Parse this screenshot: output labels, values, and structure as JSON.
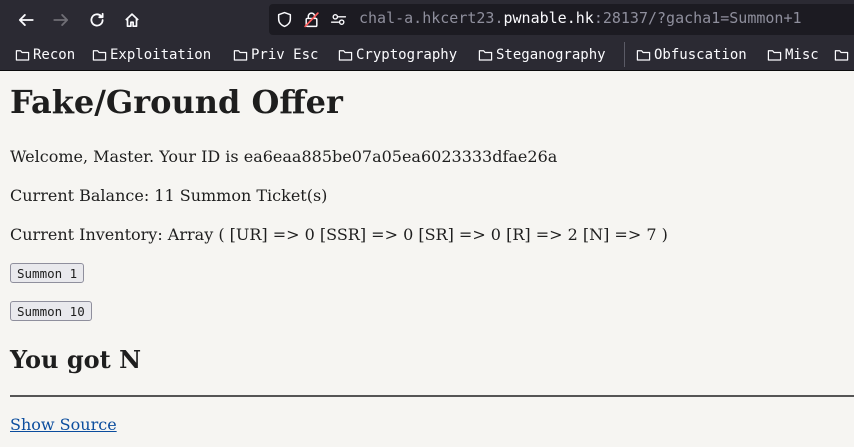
{
  "browser": {
    "url_prefix": "chal-a.hkcert23.",
    "url_host": "pwnable.hk",
    "url_suffix": ":28137/?gacha1=Summon+1",
    "bookmarks": [
      "Recon",
      "Exploitation",
      "Priv Esc",
      "Cryptography",
      "Steganography",
      "Obfuscation",
      "Misc"
    ]
  },
  "page": {
    "title": "Fake/Ground Offer",
    "welcome": "Welcome, Master. Your ID is ea6eaa885be07a05ea6023333dfae26a",
    "balance": "Current Balance: 11 Summon Ticket(s)",
    "inventory": "Current Inventory: Array ( [UR] => 0 [SSR] => 0 [SR] => 0 [R] => 2 [N] => 7 )",
    "summon1_label": "Summon 1",
    "summon10_label": "Summon 10",
    "result": "You got N",
    "show_source": "Show Source"
  }
}
